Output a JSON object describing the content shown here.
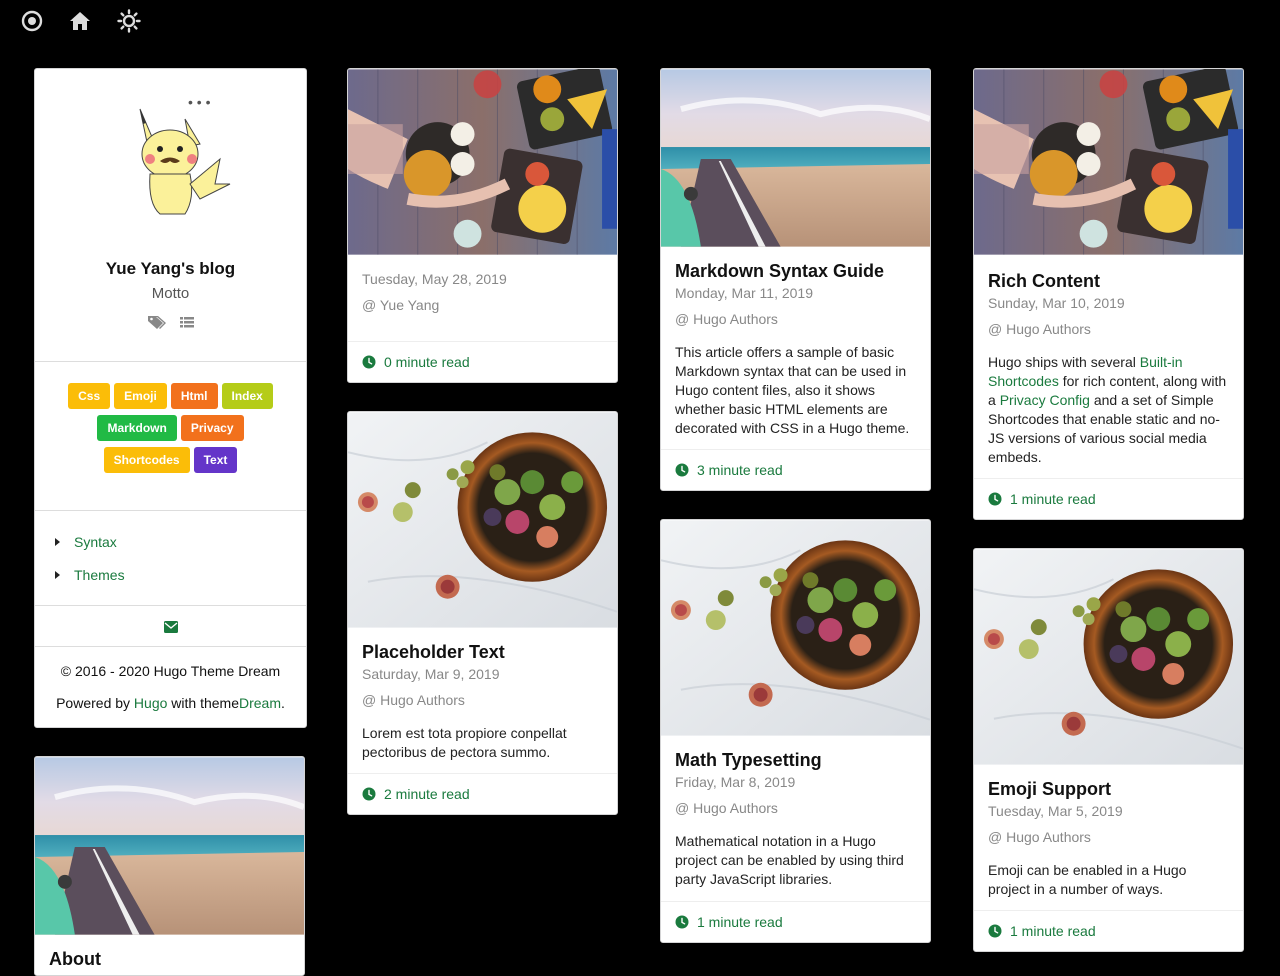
{
  "topbar": {
    "icons": [
      "target-icon",
      "home-icon",
      "sun-icon"
    ]
  },
  "sidebar": {
    "blog_name": "Yue Yang's blog",
    "motto": "Motto",
    "tags": [
      {
        "label": "Css",
        "color": "#fbbd08"
      },
      {
        "label": "Emoji",
        "color": "#fbbd08"
      },
      {
        "label": "Html",
        "color": "#f2711c"
      },
      {
        "label": "Index",
        "color": "#b5cc18"
      },
      {
        "label": "Markdown",
        "color": "#21ba45"
      },
      {
        "label": "Privacy",
        "color": "#f2711c"
      },
      {
        "label": "Shortcodes",
        "color": "#fbbd08"
      },
      {
        "label": "Text",
        "color": "#6435c9"
      }
    ],
    "menu": [
      {
        "label": "Syntax"
      },
      {
        "label": "Themes"
      }
    ],
    "copyright": "© 2016 - 2020 Hugo Theme Dream",
    "powered_prefix": "Powered by",
    "powered_hugo": "Hugo",
    "powered_mid": "with theme",
    "powered_dream": "Dream",
    "powered_suffix": ".",
    "about_title": "About"
  },
  "posts": [
    {
      "date": "Tuesday, May 28, 2019",
      "author": "@ Yue Yang",
      "read": "0 minute read"
    },
    {
      "title": "Placeholder Text",
      "date": "Saturday, Mar 9, 2019",
      "author": "@ Hugo Authors",
      "desc": "Lorem est tota propiore conpellat pectoribus de pectora summo.",
      "read": "2 minute read"
    },
    {
      "title": "Markdown Syntax Guide",
      "date": "Monday, Mar 11, 2019",
      "author": "@ Hugo Authors",
      "desc": "This article offers a sample of basic Markdown syntax that can be used in Hugo content files, also it shows whether basic HTML elements are decorated with CSS in a Hugo theme.",
      "read": "3 minute read"
    },
    {
      "title": "Math Typesetting",
      "date": "Friday, Mar 8, 2019",
      "author": "@ Hugo Authors",
      "desc": "Mathematical notation in a Hugo project can be enabled by using third party JavaScript libraries.",
      "read": "1 minute read"
    },
    {
      "title": "Rich Content",
      "date": "Sunday, Mar 10, 2019",
      "author": "@ Hugo Authors",
      "desc_pre": "Hugo ships with several",
      "desc_link1": "Built-in Shortcodes",
      "desc_mid": "for rich content, along with a",
      "desc_link2": "Privacy Config",
      "desc_post": "and a set of Simple Shortcodes that enable static and no-JS versions of various social media embeds.",
      "read": "1 minute read"
    },
    {
      "title": "Emoji Support",
      "date": "Tuesday, Mar 5, 2019",
      "author": "@ Hugo Authors",
      "desc": "Emoji can be enabled in a Hugo project in a number of ways.",
      "read": "1 minute read"
    }
  ],
  "colors": {
    "accent": "#1a7a3e",
    "background": "#000000"
  }
}
